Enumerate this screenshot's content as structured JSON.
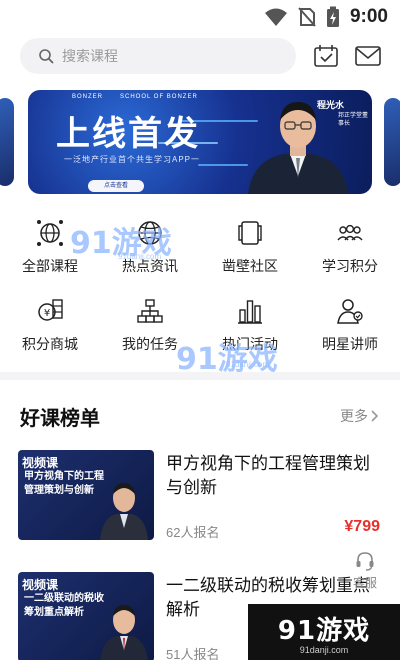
{
  "status_bar": {
    "time": "9:00"
  },
  "search": {
    "placeholder": "搜索课程"
  },
  "banner": {
    "brand_left": "BONZER",
    "brand_right": "SCHOOL OF BONZER",
    "headline": "上线首发",
    "subline": "一泛地产行业首个共生学习APP一",
    "cta": "点击查看",
    "speaker_name": "程光水",
    "speaker_title": "邦正学堂董事长"
  },
  "grid": {
    "items": [
      {
        "label": "全部课程",
        "icon": "globe-network-icon"
      },
      {
        "label": "热点资讯",
        "icon": "globe-icon"
      },
      {
        "label": "凿壁社区",
        "icon": "community-card-icon"
      },
      {
        "label": "学习积分",
        "icon": "group-people-icon"
      },
      {
        "label": "积分商城",
        "icon": "coin-store-icon"
      },
      {
        "label": "我的任务",
        "icon": "task-tree-icon"
      },
      {
        "label": "热门活动",
        "icon": "bar-chart-icon"
      },
      {
        "label": "明星讲师",
        "icon": "teacher-icon"
      }
    ]
  },
  "section": {
    "title": "好课榜单",
    "more": "更多"
  },
  "courses": [
    {
      "tag": "视频课",
      "thumb_title": "甲方视角下的工程管理策划与创新",
      "title": "甲方视角下的工程管理策划与创新",
      "count": "62人报名",
      "price": "¥799"
    },
    {
      "tag": "视频课",
      "thumb_title": "一二级联动的税收筹划重点解析",
      "title": "一二级联动的税收筹划重点解析",
      "count": "51人报名",
      "price": ""
    }
  ],
  "kefu": {
    "label": "客服"
  },
  "watermark": {
    "text": "91游戏",
    "site": "91danji.com"
  }
}
